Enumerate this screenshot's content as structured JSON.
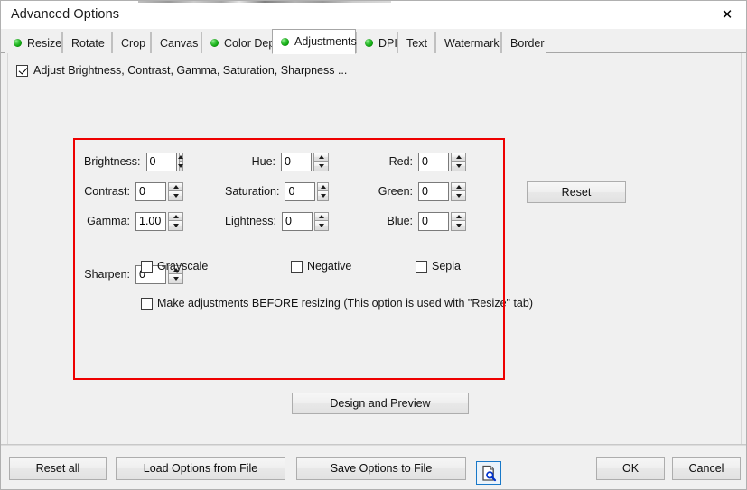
{
  "window": {
    "title": "Advanced Options",
    "close_label": "✕"
  },
  "tabs": [
    {
      "label": "Resize",
      "bullet": true,
      "active": false
    },
    {
      "label": "Rotate",
      "bullet": false,
      "active": false
    },
    {
      "label": "Crop",
      "bullet": false,
      "active": false
    },
    {
      "label": "Canvas",
      "bullet": false,
      "active": false
    },
    {
      "label": "Color Depth",
      "bullet": true,
      "active": false
    },
    {
      "label": "Adjustments",
      "bullet": true,
      "active": true
    },
    {
      "label": "DPI",
      "bullet": true,
      "active": false
    },
    {
      "label": "Text",
      "bullet": false,
      "active": false
    },
    {
      "label": "Watermark",
      "bullet": false,
      "active": false
    },
    {
      "label": "Border",
      "bullet": false,
      "active": false
    }
  ],
  "enable_option": {
    "label": "Adjust Brightness, Contrast, Gamma, Saturation, Sharpness ...",
    "checked": true
  },
  "fields": {
    "column1": [
      {
        "label": "Brightness:",
        "value": "0"
      },
      {
        "label": "Contrast:",
        "value": "0"
      },
      {
        "label": "Gamma:",
        "value": "1.00"
      }
    ],
    "column2": [
      {
        "label": "Hue:",
        "value": "0"
      },
      {
        "label": "Saturation:",
        "value": "0"
      },
      {
        "label": "Lightness:",
        "value": "0"
      }
    ],
    "column3": [
      {
        "label": "Red:",
        "value": "0"
      },
      {
        "label": "Green:",
        "value": "0"
      },
      {
        "label": "Blue:",
        "value": "0"
      }
    ],
    "sharpen": {
      "label": "Sharpen:",
      "value": "0"
    }
  },
  "toggles": [
    {
      "label": "Grayscale",
      "checked": false
    },
    {
      "label": "Negative",
      "checked": false
    },
    {
      "label": "Sepia",
      "checked": false
    }
  ],
  "before_resize": {
    "label": "Make adjustments BEFORE resizing (This option is used with \"Resize\" tab)",
    "checked": false
  },
  "buttons": {
    "reset": "Reset",
    "design_preview": "Design and Preview",
    "reset_all": "Reset all",
    "load_options": "Load Options from File",
    "save_options": "Save Options to File",
    "ok": "OK",
    "cancel": "Cancel"
  },
  "icons": {
    "preview_document": "document-magnifier-icon"
  },
  "colors": {
    "highlight_border": "#ee0000",
    "tab_bullet": "#16a816",
    "dialog_background": "#f0f0f0",
    "preview_icon_border": "#1878c8"
  }
}
